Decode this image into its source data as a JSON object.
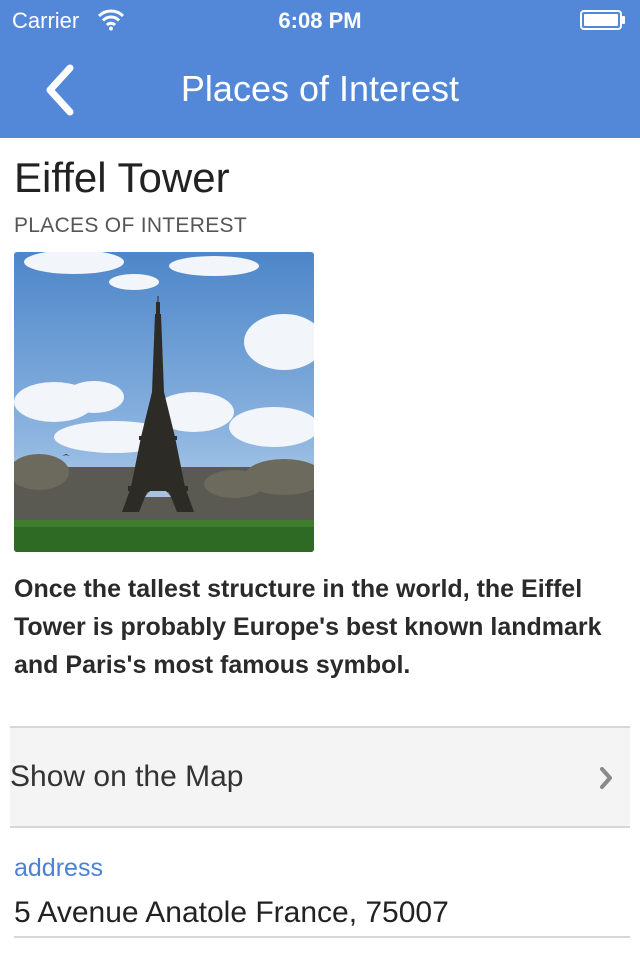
{
  "status_bar": {
    "carrier": "Carrier",
    "time": "6:08 PM"
  },
  "nav": {
    "title": "Places of Interest",
    "back_icon": "chevron-left-icon"
  },
  "place": {
    "title": "Eiffel Tower",
    "category": "PLACES OF INTEREST",
    "description": "Once the tallest structure in the world, the Eiffel Tower is probably Europe's best known landmark and Paris's most famous symbol."
  },
  "map_link": {
    "label": "Show on the Map",
    "icon": "chevron-right-icon"
  },
  "address": {
    "label": "address",
    "value": "5 Avenue Anatole France, 75007"
  },
  "colors": {
    "nav_background": "#5387d8",
    "link": "#4b82d6"
  }
}
